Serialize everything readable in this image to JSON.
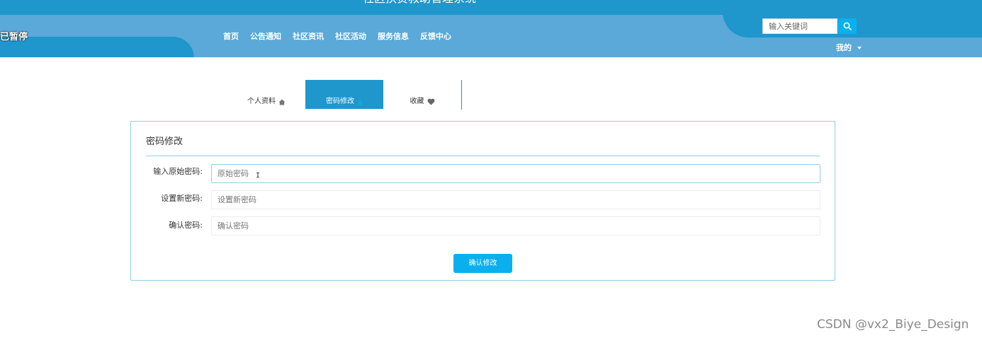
{
  "header": {
    "site_title": "社区扶贫救助管理系统",
    "paused_label": "已暂停",
    "nav": [
      {
        "label": "首页"
      },
      {
        "label": "公告通知"
      },
      {
        "label": "社区资讯"
      },
      {
        "label": "社区活动"
      },
      {
        "label": "服务信息"
      },
      {
        "label": "反馈中心"
      }
    ],
    "search": {
      "placeholder": "输入关键词",
      "icon": "search-icon"
    },
    "user_menu": {
      "label": "我的",
      "icon": "caret-down-icon"
    }
  },
  "tabs": [
    {
      "label": "个人资料",
      "icon": "home-icon",
      "active": false
    },
    {
      "label": "密码修改",
      "icon": "lock-icon",
      "active": true
    },
    {
      "label": "收藏",
      "icon": "heart-icon",
      "active": false
    }
  ],
  "panel": {
    "title": "密码修改",
    "fields": [
      {
        "label": "输入原始密码:",
        "placeholder": "原始密码",
        "focused": true
      },
      {
        "label": "设置新密码:",
        "placeholder": "设置新密码",
        "focused": false
      },
      {
        "label": "确认密码:",
        "placeholder": "确认密码",
        "focused": false
      }
    ],
    "submit_label": "确认修改"
  },
  "watermark": "CSDN @vx2_Biye_Design",
  "colors": {
    "header_dark": "#1f96cc",
    "header_light": "#5aa9d8",
    "accent_button": "#0ab0ee",
    "panel_border": "#8fd0e6"
  }
}
